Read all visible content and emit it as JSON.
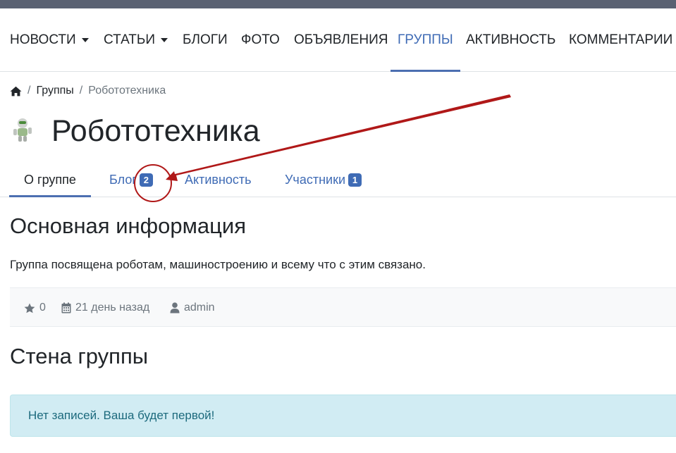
{
  "nav": {
    "items": [
      {
        "label": "НОВОСТИ"
      },
      {
        "label": "СТАТЬИ"
      },
      {
        "label": "БЛОГИ"
      },
      {
        "label": "ФОТО"
      },
      {
        "label": "ОБЪЯВЛЕНИЯ"
      },
      {
        "label": "ГРУППЫ"
      },
      {
        "label": "АКТИВНОСТЬ"
      },
      {
        "label": "КОММЕНТАРИИ"
      }
    ],
    "active": "ГРУППЫ"
  },
  "breadcrumb": {
    "home_icon": "home-icon",
    "separator": "/",
    "items": [
      "Группы",
      "Робототехника"
    ]
  },
  "group": {
    "logo_icon": "robot-logo",
    "title": "Робототехника"
  },
  "tabs": [
    {
      "label": "О группе",
      "active": true
    },
    {
      "label": "Блог",
      "badge": "2"
    },
    {
      "label": "Активность"
    },
    {
      "label": "Участники",
      "badge": "1"
    }
  ],
  "info": {
    "heading": "Основная информация",
    "description": "Группа посвящена роботам, машиностроению и всему что с этим связано."
  },
  "meta": {
    "rating": "0",
    "date": "21 день назад",
    "author": "admin"
  },
  "wall": {
    "heading": "Стена группы",
    "empty_message": "Нет записей. Ваша будет первой!"
  },
  "colors": {
    "accent": "#3f6bb5",
    "annotation": "#b01818",
    "alert_bg": "#d1ecf3"
  }
}
